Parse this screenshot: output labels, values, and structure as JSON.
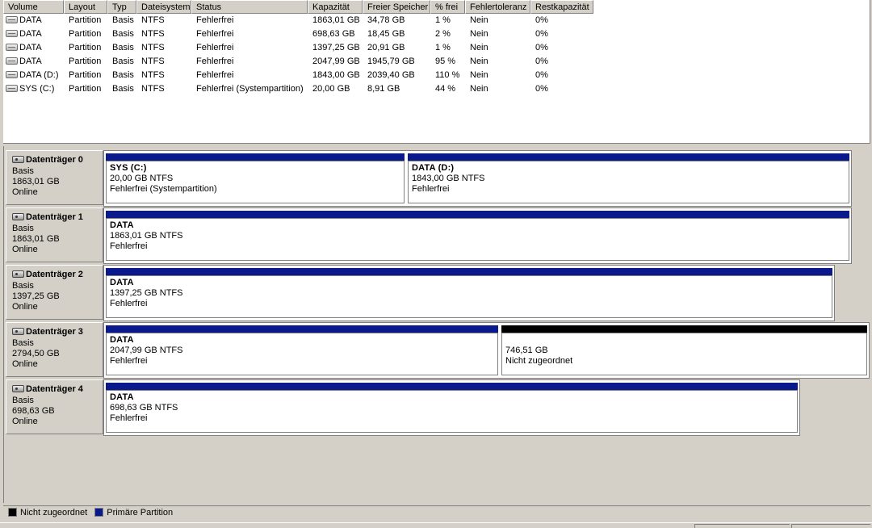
{
  "volume_list": {
    "columns": [
      "Volume",
      "Layout",
      "Typ",
      "Dateisystem",
      "Status",
      "Kapazität",
      "Freier Speicher",
      "% frei",
      "Fehlertoleranz",
      "Restkapazität"
    ],
    "rows": [
      [
        "DATA",
        "Partition",
        "Basis",
        "NTFS",
        "Fehlerfrei",
        "1863,01 GB",
        "34,78 GB",
        "1 %",
        "Nein",
        "0%"
      ],
      [
        "DATA",
        "Partition",
        "Basis",
        "NTFS",
        "Fehlerfrei",
        "698,63 GB",
        "18,45 GB",
        "2 %",
        "Nein",
        "0%"
      ],
      [
        "DATA",
        "Partition",
        "Basis",
        "NTFS",
        "Fehlerfrei",
        "1397,25 GB",
        "20,91 GB",
        "1 %",
        "Nein",
        "0%"
      ],
      [
        "DATA",
        "Partition",
        "Basis",
        "NTFS",
        "Fehlerfrei",
        "2047,99 GB",
        "1945,79 GB",
        "95 %",
        "Nein",
        "0%"
      ],
      [
        "DATA (D:)",
        "Partition",
        "Basis",
        "NTFS",
        "Fehlerfrei",
        "1843,00 GB",
        "2039,40 GB",
        "110 %",
        "Nein",
        "0%"
      ],
      [
        "SYS (C:)",
        "Partition",
        "Basis",
        "NTFS",
        "Fehlerfrei (Systempartition)",
        "20,00 GB",
        "8,91 GB",
        "44 %",
        "Nein",
        "0%"
      ]
    ]
  },
  "disks": [
    {
      "title": "Datenträger 0",
      "type": "Basis",
      "size": "1863,01 GB",
      "status": "Online",
      "partitions": [
        {
          "kind": "primary",
          "name": "SYS  (C:)",
          "size": "20,00 GB NTFS",
          "status": "Fehlerfrei (Systempartition)"
        },
        {
          "kind": "primary",
          "name": "DATA  (D:)",
          "size": "1843,00 GB NTFS",
          "status": "Fehlerfrei"
        }
      ]
    },
    {
      "title": "Datenträger 1",
      "type": "Basis",
      "size": "1863,01 GB",
      "status": "Online",
      "partitions": [
        {
          "kind": "primary",
          "name": "DATA",
          "size": "1863,01 GB NTFS",
          "status": "Fehlerfrei"
        }
      ]
    },
    {
      "title": "Datenträger 2",
      "type": "Basis",
      "size": "1397,25 GB",
      "status": "Online",
      "partitions": [
        {
          "kind": "primary",
          "name": "DATA",
          "size": "1397,25 GB NTFS",
          "status": "Fehlerfrei"
        }
      ]
    },
    {
      "title": "Datenträger 3",
      "type": "Basis",
      "size": "2794,50 GB",
      "status": "Online",
      "partitions": [
        {
          "kind": "primary",
          "name": "DATA",
          "size": "2047,99 GB NTFS",
          "status": "Fehlerfrei"
        },
        {
          "kind": "unallocated",
          "name": "",
          "size": "746,51 GB",
          "status": "Nicht zugeordnet"
        }
      ]
    },
    {
      "title": "Datenträger 4",
      "type": "Basis",
      "size": "698,63 GB",
      "status": "Online",
      "partitions": [
        {
          "kind": "primary",
          "name": "DATA",
          "size": "698,63 GB NTFS",
          "status": "Fehlerfrei"
        }
      ]
    }
  ],
  "legend": [
    {
      "label": "Nicht zugeordnet",
      "color": "#000000"
    },
    {
      "label": "Primäre Partition",
      "color": "#0a1a8c"
    }
  ],
  "colors": {
    "primary_partition": "#0a1a8c",
    "unallocated": "#000000",
    "window_background": "#d4d0c8"
  }
}
